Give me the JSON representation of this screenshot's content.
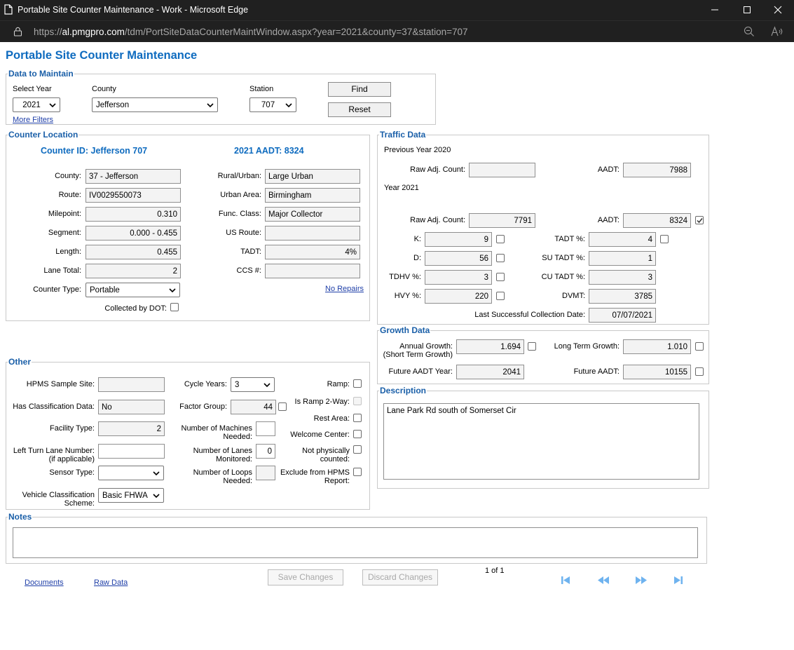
{
  "window": {
    "title": "Portable Site Counter Maintenance - Work - Microsoft Edge",
    "url_prefix": "https://",
    "url_host": "al.pmgpro.com",
    "url_path": "/tdm/PortSiteDataCounterMaintWindow.aspx?year=2021&county=37&station=707"
  },
  "page_title": "Portable Site Counter Maintenance",
  "data_to_maintain": {
    "legend": "Data to Maintain",
    "year_label": "Select Year",
    "year_value": "2021",
    "county_label": "County",
    "county_value": "Jefferson",
    "station_label": "Station",
    "station_value": "707",
    "find_label": "Find",
    "reset_label": "Reset",
    "more_filters": "More Filters"
  },
  "counter_location": {
    "legend": "Counter Location",
    "counter_id": "Counter ID: Jefferson 707",
    "aadt_head": "2021 AADT: 8324",
    "county_label": "County:",
    "county_value": "37 - Jefferson",
    "route_label": "Route:",
    "route_value": "IV0029550073",
    "milepoint_label": "Milepoint:",
    "milepoint_value": "0.310",
    "segment_label": "Segment:",
    "segment_value": "0.000 - 0.455",
    "length_label": "Length:",
    "length_value": "0.455",
    "lane_total_label": "Lane Total:",
    "lane_total_value": "2",
    "counter_type_label": "Counter Type:",
    "counter_type_value": "Portable",
    "collected_label": "Collected by DOT:",
    "rural_urban_label": "Rural/Urban:",
    "rural_urban_value": "Large Urban",
    "urban_area_label": "Urban Area:",
    "urban_area_value": "Birmingham",
    "func_class_label": "Func. Class:",
    "func_class_value": "Major Collector",
    "us_route_label": "US Route:",
    "us_route_value": "",
    "tadt_label": "TADT:",
    "tadt_value": "4%",
    "ccs_label": "CCS #:",
    "ccs_value": "",
    "no_repairs": "No Repairs"
  },
  "traffic_data": {
    "legend": "Traffic Data",
    "prev_year": "Previous Year 2020",
    "prev_raw_label": "Raw Adj. Count:",
    "prev_raw_value": "",
    "prev_aadt_label": "AADT:",
    "prev_aadt_value": "7988",
    "year": "Year 2021",
    "raw_label": "Raw Adj. Count:",
    "raw_value": "7791",
    "aadt_label": "AADT:",
    "aadt_value": "8324",
    "k_label": "K:",
    "k_value": "9",
    "d_label": "D:",
    "d_value": "56",
    "tdhv_label": "TDHV %:",
    "tdhv_value": "3",
    "hvy_label": "HVY %:",
    "hvy_value": "220",
    "tadt_label": "TADT %:",
    "tadt_value": "4",
    "su_label": "SU TADT %:",
    "su_value": "1",
    "cu_label": "CU TADT %:",
    "cu_value": "3",
    "dvmt_label": "DVMT:",
    "dvmt_value": "3785",
    "last_label": "Last Successful Collection Date:",
    "last_value": "07/07/2021"
  },
  "growth_data": {
    "legend": "Growth Data",
    "annual_label": "Annual Growth:",
    "annual_sub": "(Short Term Growth)",
    "annual_value": "1.694",
    "long_label": "Long Term Growth:",
    "long_value": "1.010",
    "future_year_label": "Future AADT Year:",
    "future_year_value": "2041",
    "future_aadt_label": "Future AADT:",
    "future_aadt_value": "10155"
  },
  "description": {
    "legend": "Description",
    "text": "Lane Park Rd south of Somerset Cir"
  },
  "other": {
    "legend": "Other",
    "hpms_label": "HPMS Sample Site:",
    "hpms_value": "",
    "class_data_label": "Has Classification Data:",
    "class_data_value": "No",
    "facility_label": "Facility Type:",
    "facility_value": "2",
    "left_turn_label": "Left Turn Lane Number:",
    "left_turn_sub": "(if applicable)",
    "left_turn_value": "",
    "sensor_label": "Sensor Type:",
    "sensor_value": "",
    "vcs_label": "Vehicle Classification",
    "vcs_sub": "Scheme:",
    "vcs_value": "Basic FHWA",
    "cycle_label": "Cycle Years:",
    "cycle_value": "3",
    "factor_label": "Factor Group:",
    "factor_value": "44",
    "machines_label": "Number of Machines",
    "machines_sub": "Needed:",
    "machines_value": "",
    "lanes_label": "Number of Lanes",
    "lanes_sub": "Monitored:",
    "lanes_value": "0",
    "loops_label": "Number of Loops",
    "loops_sub": "Needed:",
    "loops_value": "",
    "ramp_label": "Ramp:",
    "ramp2_label": "Is Ramp 2-Way:",
    "rest_label": "Rest Area:",
    "welcome_label": "Welcome Center:",
    "notphys_label": "Not physically",
    "notphys_sub": "counted:",
    "exclude_label": "Exclude from HPMS",
    "exclude_sub": "Report:"
  },
  "notes": {
    "legend": "Notes",
    "text": ""
  },
  "footer": {
    "documents": "Documents",
    "raw_data": "Raw Data",
    "save": "Save Changes",
    "discard": "Discard Changes",
    "pager": "1 of 1"
  },
  "icons": {
    "nav_color": "#6fb3ef"
  }
}
